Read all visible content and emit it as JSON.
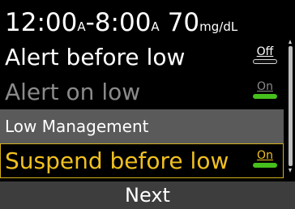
{
  "header": {
    "start_time": "12:00",
    "start_ampm": "A",
    "dash": "-",
    "end_time": "8:00",
    "end_ampm": "A",
    "glucose_value": "70",
    "glucose_unit": "mg/dL"
  },
  "settings": [
    {
      "label": "Alert before low",
      "toggle": "Off",
      "state": "off",
      "enabled": true,
      "selected": false
    },
    {
      "label": "Alert on low",
      "toggle": "On",
      "state": "on",
      "enabled": false,
      "selected": false
    },
    {
      "section_title": "Low Management"
    },
    {
      "label": "Suspend before low",
      "toggle": "On",
      "state": "on",
      "enabled": true,
      "selected": true
    }
  ],
  "footer": {
    "next_label": "Next"
  },
  "colors": {
    "background": "#000000",
    "selected_text": "#f0c020",
    "selected_border": "#d4b01c",
    "toggle_on": "#46c01c",
    "section_band": "#5a5a5a",
    "disabled_text": "#8a8a8a",
    "footer_bar": "#3d3d3d"
  }
}
